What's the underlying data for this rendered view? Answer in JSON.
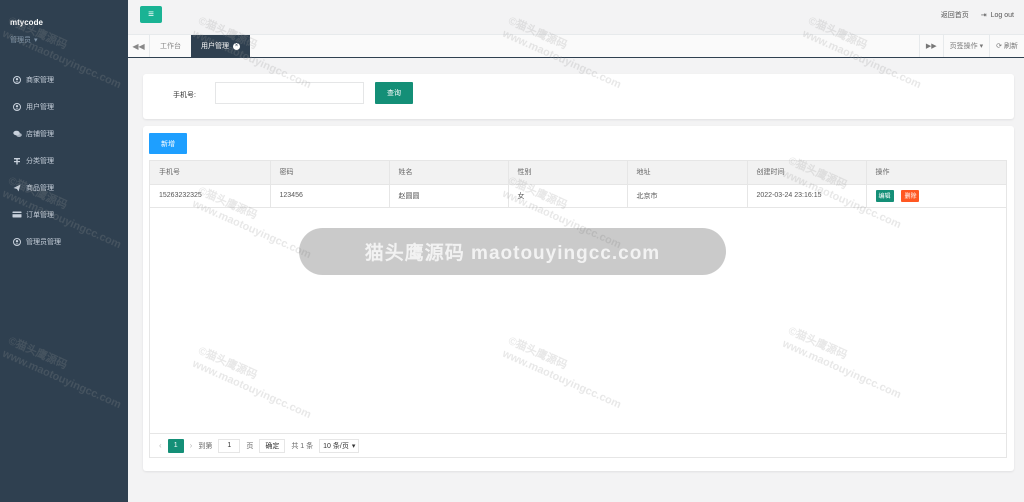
{
  "sidebar": {
    "username": "mtycode",
    "role": "管理员",
    "items": [
      {
        "label": "商家管理",
        "icon": "user-circle-icon"
      },
      {
        "label": "用户管理",
        "icon": "user-circle-icon"
      },
      {
        "label": "店铺管理",
        "icon": "comments-icon"
      },
      {
        "label": "分类管理",
        "icon": "sitemap-icon"
      },
      {
        "label": "商品管理",
        "icon": "paper-plane-icon"
      },
      {
        "label": "订单管理",
        "icon": "credit-card-icon"
      },
      {
        "label": "管理员管理",
        "icon": "user-circle-icon"
      }
    ]
  },
  "topbar": {
    "back_home": "返回首页",
    "logout": "Log out"
  },
  "tabs": {
    "items": [
      {
        "label": "工作台"
      },
      {
        "label": "用户管理"
      }
    ],
    "page_ops": "页签操作",
    "refresh": "刷新"
  },
  "search": {
    "phone_label": "手机号:",
    "phone_value": "",
    "query_button": "查询"
  },
  "table": {
    "add_button": "新增",
    "columns": [
      "手机号",
      "密码",
      "姓名",
      "性别",
      "地址",
      "创建时间",
      "操作"
    ],
    "rows": [
      [
        "15263232325",
        "123456",
        "赵圆圆",
        "女",
        "北京市",
        "2022-03-24 23:16:15"
      ]
    ],
    "edit_label": "编辑",
    "delete_label": "删除"
  },
  "pager": {
    "current": "1",
    "goto_label": "到第",
    "goto_value": "1",
    "page_label": "页",
    "confirm": "确定",
    "total": "共 1 条",
    "page_size": "10 条/页"
  },
  "watermark": {
    "site_text": "www.maotouyingcc.com",
    "brand_text": "©猫头鹰源码",
    "toast_text": "猫头鹰源码 maotouyingcc.com"
  },
  "colors": {
    "sidebar_bg": "#2f4050",
    "accent_green": "#148f77",
    "accent_blue": "#1e9fff",
    "danger": "#ff5722"
  }
}
